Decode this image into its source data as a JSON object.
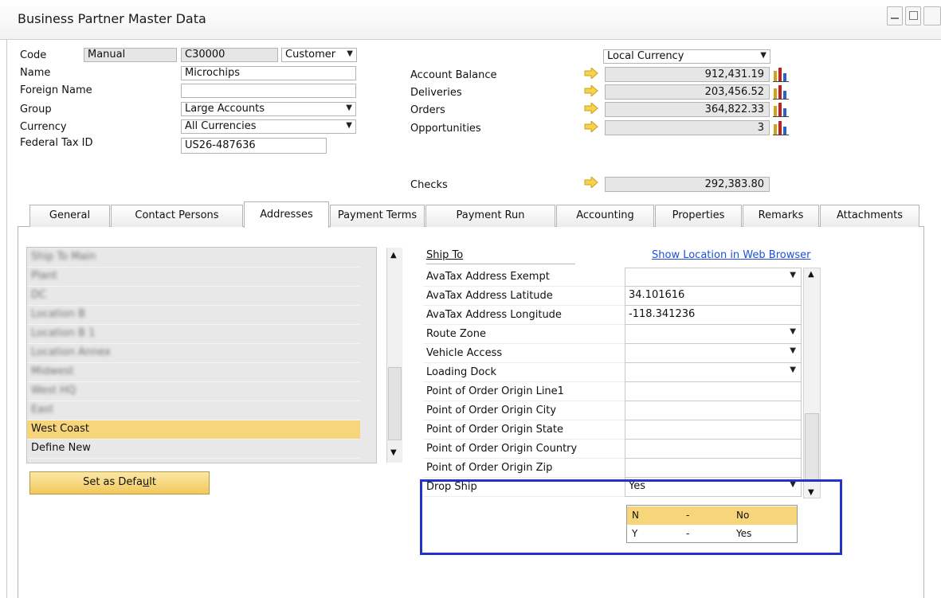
{
  "window": {
    "title": "Business Partner Master Data"
  },
  "header": {
    "code_label": "Code",
    "code_series": "Manual",
    "code_value": "C30000",
    "bp_type": "Customer",
    "name_label": "Name",
    "name_value": "Microchips",
    "foreign_name_label": "Foreign Name",
    "foreign_name_value": "",
    "group_label": "Group",
    "group_value": "Large Accounts",
    "currency_label": "Currency",
    "currency_value": "All Currencies",
    "federal_tax_label": "Federal Tax ID",
    "federal_tax_value": "US26-487636",
    "currency_mode": "Local Currency",
    "balances": [
      {
        "label": "Account Balance",
        "value": "912,431.19"
      },
      {
        "label": "Deliveries",
        "value": "203,456.52"
      },
      {
        "label": "Orders",
        "value": "364,822.33"
      },
      {
        "label": "Opportunities",
        "value": "3"
      }
    ],
    "checks_label": "Checks",
    "checks_value": "292,383.80"
  },
  "tabs": [
    {
      "label": "General"
    },
    {
      "label": "Contact Persons"
    },
    {
      "label": "Addresses",
      "active": true
    },
    {
      "label": "Payment Terms"
    },
    {
      "label": "Payment Run"
    },
    {
      "label": "Accounting"
    },
    {
      "label": "Properties"
    },
    {
      "label": "Remarks"
    },
    {
      "label": "Attachments"
    }
  ],
  "addresses": {
    "items": [
      {
        "label": "Ship To Main",
        "blurred": true
      },
      {
        "label": "Plant",
        "blurred": true
      },
      {
        "label": "DC",
        "blurred": true
      },
      {
        "label": "Location B",
        "blurred": true
      },
      {
        "label": "Location B 1",
        "blurred": true
      },
      {
        "label": "Location Annex",
        "blurred": true
      },
      {
        "label": "Midwest",
        "blurred": true
      },
      {
        "label": "West HQ",
        "blurred": true
      },
      {
        "label": "East",
        "blurred": true
      },
      {
        "label": "West Coast",
        "selected": true
      },
      {
        "label": "Define New"
      }
    ],
    "set_default_label": "Set as Default"
  },
  "shipto": {
    "heading": "Ship To",
    "web_link": "Show Location in Web Browser",
    "rows": [
      {
        "label": "AvaTax Address Exempt",
        "value": "",
        "dropdown": true
      },
      {
        "label": "AvaTax Address Latitude",
        "value": "34.101616"
      },
      {
        "label": "AvaTax Address Longitude",
        "value": "-118.341236"
      },
      {
        "label": "Route Zone",
        "value": "",
        "dropdown": true
      },
      {
        "label": "Vehicle Access",
        "value": "",
        "dropdown": true
      },
      {
        "label": "Loading Dock",
        "value": "",
        "dropdown": true
      },
      {
        "label": "Point of Order Origin Line1",
        "value": ""
      },
      {
        "label": "Point of Order Origin City",
        "value": ""
      },
      {
        "label": "Point of Order Origin State",
        "value": ""
      },
      {
        "label": "Point of Order Origin Country",
        "value": ""
      },
      {
        "label": "Point of Order Origin Zip",
        "value": ""
      },
      {
        "label": "Drop Ship",
        "value": "Yes",
        "dropdown": true
      }
    ],
    "dropdown_options": [
      {
        "code": "N",
        "sep": "-",
        "desc": "No",
        "highlighted": true
      },
      {
        "code": "Y",
        "sep": "-",
        "desc": "Yes"
      }
    ]
  },
  "colors": {
    "selection": "#f7d57a",
    "highlight_border": "#2233cc",
    "link": "#1f4fd8"
  },
  "icons": {
    "arrow": "yellow-arrow-icon",
    "chart": "bar-chart-icon"
  }
}
